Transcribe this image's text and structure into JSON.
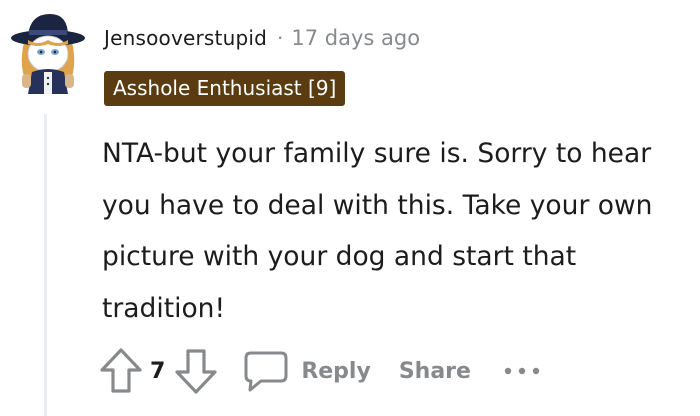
{
  "comment": {
    "username": "Jensooverstupid",
    "separator": "·",
    "timestamp": "17 days ago",
    "flair": "Asshole Enthusiast [9]",
    "flair_color": "#5a3c10",
    "body": "NTA-but your family sure is. Sorry to hear you have to deal with this. Take your own picture with your dog and start that tradition!"
  },
  "actions": {
    "upvote_icon": "arrow-up-icon",
    "vote_count": "7",
    "downvote_icon": "arrow-down-icon",
    "reply_icon": "speech-bubble-icon",
    "reply_label": "Reply",
    "share_label": "Share",
    "more_icon": "ellipsis-icon"
  },
  "colors": {
    "text": "#1c1c1c",
    "meta": "#878a8c",
    "thread_line": "#e9edf0"
  }
}
